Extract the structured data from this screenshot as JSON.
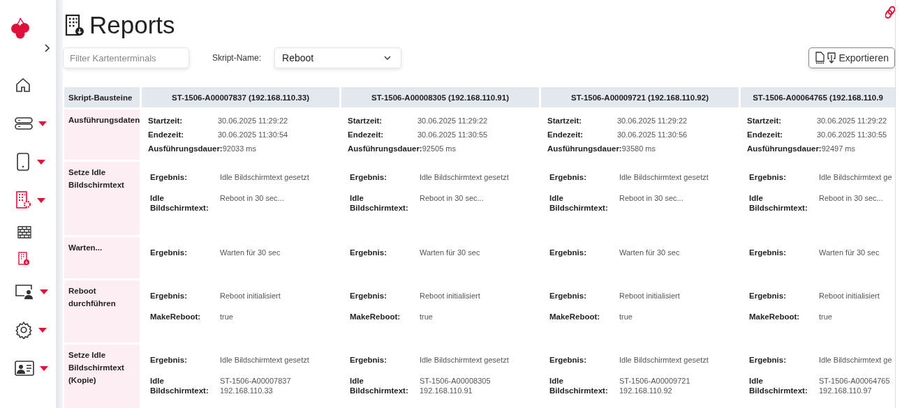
{
  "page": {
    "title": "Reports"
  },
  "sidebar": {
    "items": [
      {
        "kind": "link",
        "selected": false
      },
      {
        "kind": "menu",
        "selected": false
      },
      {
        "kind": "menu",
        "selected": false
      },
      {
        "kind": "menu",
        "selected": true,
        "children": [
          {
            "selected": false
          },
          {
            "selected": true
          }
        ]
      },
      {
        "kind": "menu",
        "selected": false
      },
      {
        "kind": "menu",
        "selected": false
      },
      {
        "kind": "menu",
        "selected": false
      }
    ]
  },
  "toolbar": {
    "filter": {
      "placeholder": "Filter Kartenterminals"
    },
    "script_label": "Skript-Name:",
    "script_select": {
      "value": "Reboot"
    },
    "export_button": "Exportieren"
  },
  "table": {
    "corner": "Skript-Bausteine",
    "columns": [
      "ST-1506-A00007837 (192.168.110.33)",
      "ST-1506-A00008305 (192.168.110.91)",
      "ST-1506-A00009721 (192.168.110.92)",
      "ST-1506-A00064765 (192.168.110.9"
    ],
    "rows": [
      {
        "label": "Ausführungsdaten",
        "kind": "timing",
        "cells": [
          {
            "fields": [
              {
                "label": "Startzeit:",
                "value": "30.06.2025 11:29:22"
              },
              {
                "label": "Endezeit:",
                "value": "30.06.2025 11:30:54"
              },
              {
                "label": "Ausführungsdauer:",
                "value": "92033 ms"
              }
            ]
          },
          {
            "fields": [
              {
                "label": "Startzeit:",
                "value": "30.06.2025 11:29:22"
              },
              {
                "label": "Endezeit:",
                "value": "30.06.2025 11:30:55"
              },
              {
                "label": "Ausführungsdauer:",
                "value": "92505 ms"
              }
            ]
          },
          {
            "fields": [
              {
                "label": "Startzeit:",
                "value": "30.06.2025 11:29:22"
              },
              {
                "label": "Endezeit:",
                "value": "30.06.2025 11:30:56"
              },
              {
                "label": "Ausführungsdauer:",
                "value": "93580 ms"
              }
            ]
          },
          {
            "fields": [
              {
                "label": "Startzeit:",
                "value": "30.06.2025 11:29:22"
              },
              {
                "label": "Endezeit:",
                "value": "30.06.2025 11:30:55"
              },
              {
                "label": "Ausführungsdauer:",
                "value": "92497 ms"
              }
            ]
          }
        ]
      },
      {
        "label": "Setze Idle Bildschirmtext",
        "kind": "result",
        "cells": [
          {
            "fields": [
              {
                "label": "Ergebnis:",
                "value": "Idle Bildschirmtext gesetzt"
              },
              {
                "label": "Idle Bildschirmtext:",
                "value": "Reboot in 30 sec..."
              }
            ]
          },
          {
            "fields": [
              {
                "label": "Ergebnis:",
                "value": "Idle Bildschirmtext gesetzt"
              },
              {
                "label": "Idle Bildschirmtext:",
                "value": "Reboot in 30 sec..."
              }
            ]
          },
          {
            "fields": [
              {
                "label": "Ergebnis:",
                "value": "Idle Bildschirmtext gesetzt"
              },
              {
                "label": "Idle Bildschirmtext:",
                "value": "Reboot in 30 sec..."
              }
            ]
          },
          {
            "fields": [
              {
                "label": "Ergebnis:",
                "value": "Idle Bildschirmtext ge"
              },
              {
                "label": "Idle Bildschirmtext:",
                "value": "Reboot in 30 sec..."
              }
            ]
          }
        ]
      },
      {
        "label": "Warten...",
        "kind": "result",
        "cells": [
          {
            "fields": [
              {
                "label": "Ergebnis:",
                "value": "Warten für 30 sec"
              }
            ]
          },
          {
            "fields": [
              {
                "label": "Ergebnis:",
                "value": "Warten für 30 sec"
              }
            ]
          },
          {
            "fields": [
              {
                "label": "Ergebnis:",
                "value": "Warten für 30 sec"
              }
            ]
          },
          {
            "fields": [
              {
                "label": "Ergebnis:",
                "value": "Warten für 30 sec"
              }
            ]
          }
        ]
      },
      {
        "label": "Reboot durchführen",
        "kind": "result",
        "cells": [
          {
            "fields": [
              {
                "label": "Ergebnis:",
                "value": "Reboot initialisiert"
              },
              {
                "label": "MakeReboot:",
                "value": "true"
              }
            ]
          },
          {
            "fields": [
              {
                "label": "Ergebnis:",
                "value": "Reboot initialisiert"
              },
              {
                "label": "MakeReboot:",
                "value": "true"
              }
            ]
          },
          {
            "fields": [
              {
                "label": "Ergebnis:",
                "value": "Reboot initialisiert"
              },
              {
                "label": "MakeReboot:",
                "value": "true"
              }
            ]
          },
          {
            "fields": [
              {
                "label": "Ergebnis:",
                "value": "Reboot initialisiert"
              },
              {
                "label": "MakeReboot:",
                "value": "true"
              }
            ]
          }
        ]
      },
      {
        "label": "Setze Idle Bildschirmtext (Kopie)",
        "kind": "result",
        "cells": [
          {
            "fields": [
              {
                "label": "Ergebnis:",
                "value": "Idle Bildschirmtext gesetzt"
              },
              {
                "label": "Idle Bildschirmtext:",
                "value": "ST-1506-A00007837\n192.168.110.33"
              }
            ]
          },
          {
            "fields": [
              {
                "label": "Ergebnis:",
                "value": "Idle Bildschirmtext gesetzt"
              },
              {
                "label": "Idle Bildschirmtext:",
                "value": "ST-1506-A00008305\n192.168.110.91"
              }
            ]
          },
          {
            "fields": [
              {
                "label": "Ergebnis:",
                "value": "Idle Bildschirmtext gesetzt"
              },
              {
                "label": "Idle Bildschirmtext:",
                "value": "ST-1506-A00009721\n192.168.110.92"
              }
            ]
          },
          {
            "fields": [
              {
                "label": "Ergebnis:",
                "value": "Idle Bildschirmtext ge"
              },
              {
                "label": "Idle Bildschirmtext:",
                "value": "ST-1506-A00064765\n192.168.110.97"
              }
            ]
          }
        ]
      }
    ]
  }
}
